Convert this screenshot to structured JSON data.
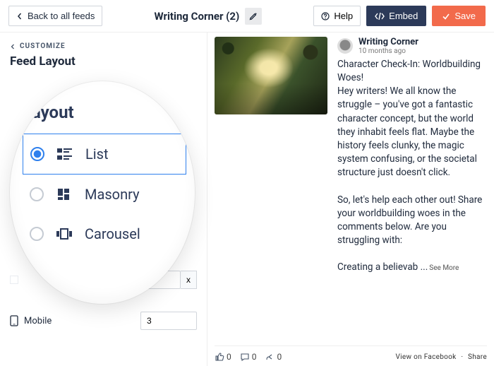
{
  "topbar": {
    "back": "Back to all feeds",
    "title": "Writing Corner (2)",
    "help": "Help",
    "embed": "Embed",
    "save": "Save"
  },
  "sidebar": {
    "customize": "CUSTOMIZE",
    "heading": "Feed Layout",
    "layoutHeading": "Layout",
    "options": {
      "list": "List",
      "masonry": "Masonry",
      "carousel": "Carousel"
    },
    "mobile": {
      "label": "Mobile",
      "value": "3"
    }
  },
  "preview": {
    "author": "Writing Corner",
    "time": "10 months ago",
    "body1": "Character Check-In: Worldbuilding Woes!\nHey writers! We all know the struggle – you've got a fantastic character concept, but the world they inhabit feels flat. Maybe the history feels clunky, the magic system confusing, or the societal structure just doesn't click.",
    "body2": "So, let's help each other out! Share your worldbuilding woes in the comments below. Are you struggling with:",
    "body3": "Creating a believab ...",
    "seeMore": "See More",
    "likes": "0",
    "comments": "0",
    "shares": "0",
    "viewOn": "View on Facebook",
    "sep": "·",
    "share": "Share"
  }
}
